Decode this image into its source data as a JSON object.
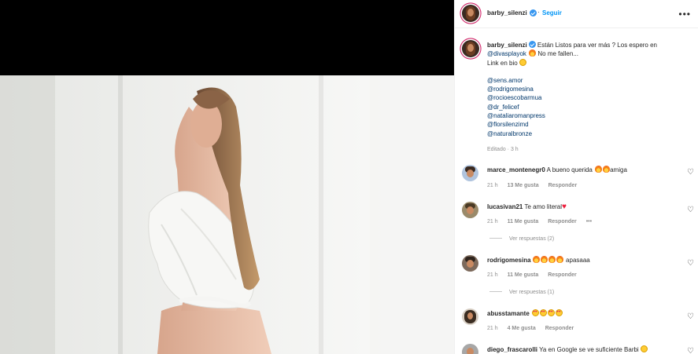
{
  "post": {
    "username": "barby_silenzi",
    "follow_label": "Seguir",
    "more_label": "•••",
    "caption_line1": "Están Listos para ver más ? Los espero en",
    "caption_mention": "@divasplayok",
    "caption_line2_rest": "No me fallen...",
    "caption_line3": "Link en bio",
    "tags": [
      "@sens.amor",
      "@rodrigomesina",
      "@rocioescobarmua",
      "@dr_felicef",
      "@nataliaromanpress",
      "@florsilenzimd",
      "@naturalbronze"
    ],
    "edited": "Editado · 3 h"
  },
  "comments": [
    {
      "user": "marce_montenegr0",
      "text": "A bueno querida",
      "suffix": "amiga",
      "time": "21 h",
      "likes": "13 Me gusta",
      "reply": "Responder"
    },
    {
      "user": "lucasivan21",
      "text": "Te amo literal",
      "time": "21 h",
      "likes": "11 Me gusta",
      "reply": "Responder",
      "more": "•••",
      "replies": "Ver respuestas (2)"
    },
    {
      "user": "rodrigomesina",
      "text": "apasaaa",
      "time": "21 h",
      "likes": "11 Me gusta",
      "reply": "Responder",
      "replies": "Ver respuestas (1)"
    },
    {
      "user": "abusstamante",
      "text": "",
      "time": "21 h",
      "likes": "4 Me gusta",
      "reply": "Responder"
    },
    {
      "user": "diego_frascarolli",
      "text": "Ya en Google se ve suficiente Barbi"
    }
  ],
  "colors": {
    "accent": "#0095f6",
    "mention": "#00376b",
    "muted": "#8e8e8e",
    "verified": "#3897f0"
  },
  "icons": [
    "verified-badge-icon",
    "more-options-icon",
    "fire-emoji-icon",
    "smile-emoji-icon",
    "heart-eyes-emoji-icon",
    "heart-emoji-icon",
    "like-heart-icon"
  ]
}
